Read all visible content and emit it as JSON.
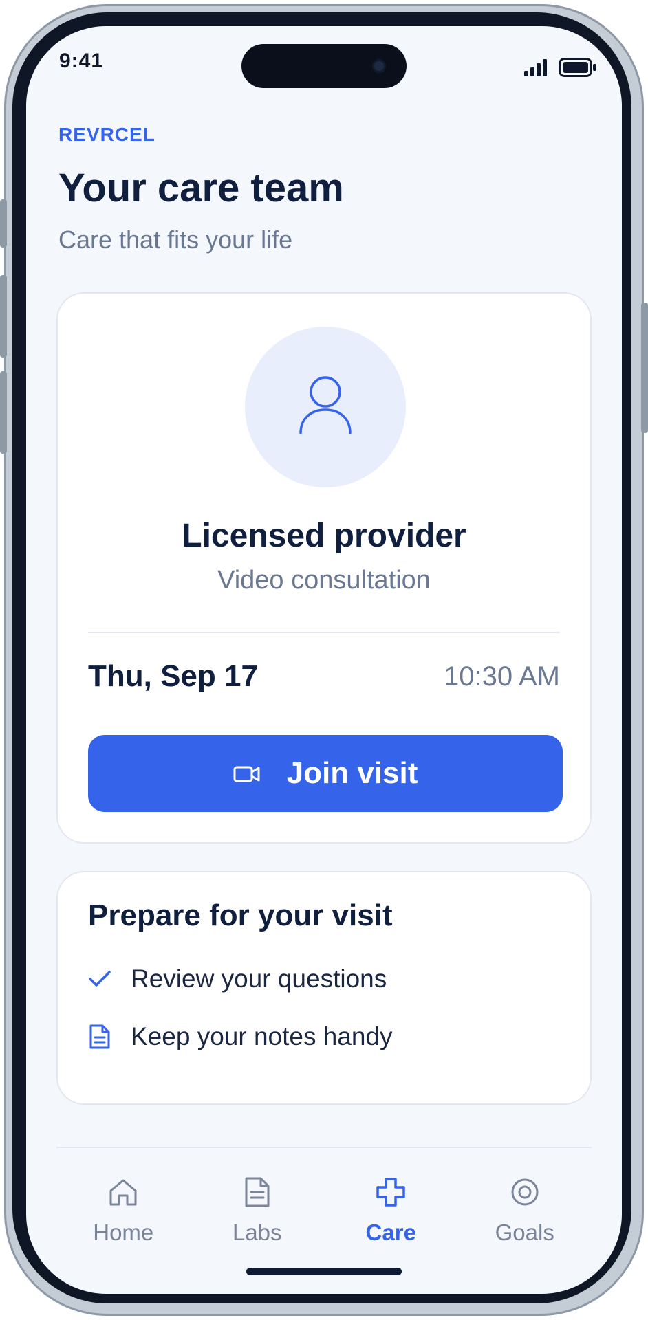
{
  "status_bar": {
    "time": "9:41",
    "icons": [
      "signal-icon",
      "battery-icon"
    ]
  },
  "header": {
    "brand": "REVRCEL",
    "title": "Your care team",
    "subtitle": "Care that fits your life"
  },
  "appointment": {
    "avatar_icon": "person-icon",
    "provider": "Licensed provider",
    "visit_type": "Video consultation",
    "date": "Thu, Sep 17",
    "time": "10:30 AM",
    "join_label": "Join visit",
    "join_icon": "video-camera-icon"
  },
  "prepare": {
    "title": "Prepare for your visit",
    "items": [
      {
        "icon": "checkmark-icon",
        "label": "Review your questions"
      },
      {
        "icon": "document-icon",
        "label": "Keep your notes handy"
      }
    ]
  },
  "tabbar": {
    "tabs": [
      {
        "label": "Home",
        "icon": "home-icon",
        "active": false
      },
      {
        "label": "Labs",
        "icon": "document-icon",
        "active": false
      },
      {
        "label": "Care",
        "icon": "plus-cross-icon",
        "active": true
      },
      {
        "label": "Goals",
        "icon": "target-icon",
        "active": false
      }
    ]
  },
  "colors": {
    "accent": "#3563e9",
    "text_primary": "#0f1f3d",
    "text_secondary": "#6b7891",
    "screen_background": "#f4f7fb",
    "card_background": "#ffffff",
    "avatar_background": "#e8eefc"
  }
}
